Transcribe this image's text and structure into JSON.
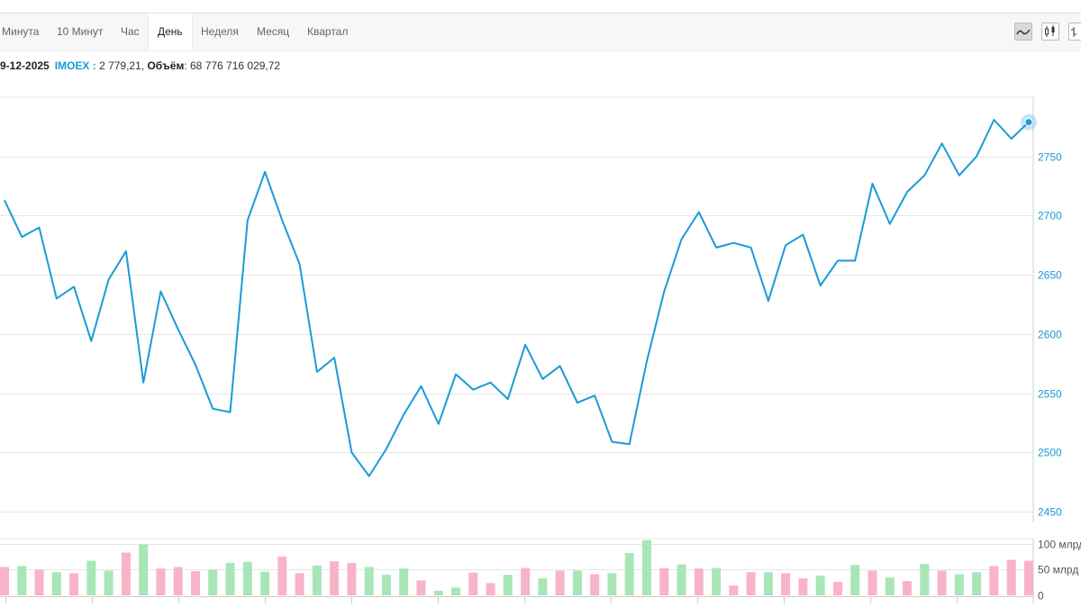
{
  "tabs": [
    {
      "label": "Минута"
    },
    {
      "label": "10 Минут"
    },
    {
      "label": "Час"
    },
    {
      "label": "День"
    },
    {
      "label": "Неделя"
    },
    {
      "label": "Месяц"
    },
    {
      "label": "Квартал"
    }
  ],
  "active_tab": "День",
  "info": {
    "date": "9-12-2025",
    "ticker": "IMOEX :",
    "value": " 2 779,21, ",
    "volume_label": "Объём",
    "volume_value": ": 68 776 716 029,72"
  },
  "colors": {
    "line": "#1a9bd7",
    "volume_up": "#a8e6b8",
    "volume_down": "#f9b3c9",
    "grid": "#e6e6e6",
    "axis_text": "#1a9bd7"
  },
  "chart_data": [
    {
      "type": "line",
      "title": "",
      "xlabel": "",
      "ylabel": "",
      "ylim": [
        2450,
        2800
      ],
      "yticks": [
        "2750",
        "2700",
        "2650",
        "2600",
        "2550",
        "2500",
        "2450"
      ],
      "ytick_values": [
        2750,
        2700,
        2650,
        2600,
        2550,
        2500,
        2450
      ],
      "grid": true,
      "series": [
        {
          "values": [
            2713,
            2682,
            2690,
            2630,
            2640,
            2594,
            2646,
            2670,
            2559,
            2636,
            2604,
            2574,
            2537,
            2534,
            2696,
            2737,
            2696,
            2659,
            2568,
            2580,
            2500,
            2480,
            2503,
            2532,
            2556,
            2524,
            2566,
            2553,
            2559,
            2545,
            2591,
            2562,
            2573,
            2542,
            2548,
            2509,
            2507,
            2577,
            2636,
            2680,
            2703,
            2673,
            2677,
            2673,
            2628,
            2675,
            2684,
            2641,
            2662,
            2662,
            2727,
            2693,
            2720,
            2734,
            2761,
            2734,
            2750,
            2781,
            2765,
            2779
          ]
        }
      ]
    },
    {
      "type": "bar",
      "title": "",
      "ylabel": "",
      "ylim": [
        0,
        110
      ],
      "yticks": [
        "100 млрд",
        "50 млрд",
        "0"
      ],
      "ytick_values": [
        100,
        50,
        0
      ],
      "series": [
        {
          "name": "",
          "values": [
            55,
            57,
            50,
            45,
            43,
            67,
            48,
            83,
            99,
            52,
            55,
            47,
            50,
            63,
            65,
            46,
            75,
            43,
            58,
            66,
            63,
            55,
            40,
            52,
            29,
            9,
            15,
            44,
            24,
            40,
            53,
            33,
            48,
            48,
            41,
            43,
            82,
            107,
            53,
            60,
            52,
            53,
            19,
            45,
            45,
            43,
            33,
            38,
            26,
            59,
            48,
            35,
            28,
            61,
            48,
            41,
            45,
            57,
            69,
            67
          ],
          "direction": [
            "down",
            "up",
            "down",
            "up",
            "down",
            "up",
            "up",
            "down",
            "up",
            "down",
            "down",
            "down",
            "up",
            "up",
            "up",
            "up",
            "down",
            "down",
            "up",
            "down",
            "down",
            "up",
            "up",
            "up",
            "down",
            "up",
            "up",
            "down",
            "down",
            "up",
            "down",
            "up",
            "down",
            "up",
            "down",
            "up",
            "up",
            "up",
            "down",
            "up",
            "down",
            "up",
            "down",
            "down",
            "up",
            "down",
            "down",
            "up",
            "down",
            "up",
            "down",
            "up",
            "down",
            "up",
            "down",
            "up",
            "up",
            "down",
            "down",
            "down"
          ]
        }
      ]
    }
  ]
}
